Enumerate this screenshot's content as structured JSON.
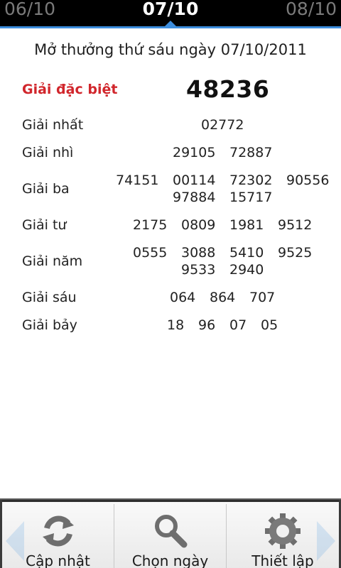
{
  "date_nav": {
    "prev": "06/10",
    "current": "07/10",
    "next": "08/10"
  },
  "heading": "Mở thưởng thứ sáu ngày 07/10/2011",
  "special": {
    "label": "Giải đặc biệt",
    "number": "48236"
  },
  "prizes": [
    {
      "label": "Giải nhất",
      "numbers": [
        "02772"
      ]
    },
    {
      "label": "Giải nhì",
      "numbers": [
        "29105",
        "72887"
      ]
    },
    {
      "label": "Giải ba",
      "numbers": [
        "74151",
        "00114",
        "72302",
        "90556",
        "97884",
        "15717"
      ]
    },
    {
      "label": "Giải tư",
      "numbers": [
        "2175",
        "0809",
        "1981",
        "9512"
      ]
    },
    {
      "label": "Giải năm",
      "numbers": [
        "0555",
        "3088",
        "5410",
        "9525",
        "9533",
        "2940"
      ]
    },
    {
      "label": "Giải sáu",
      "numbers": [
        "064",
        "864",
        "707"
      ]
    },
    {
      "label": "Giải bảy",
      "numbers": [
        "18",
        "96",
        "07",
        "05"
      ]
    }
  ],
  "toolbar": {
    "refresh_label": "Cập nhật",
    "choose_date_label": "Chọn ngày",
    "settings_label": "Thiết lập"
  },
  "colors": {
    "accent": "#3d8ede",
    "special_label": "#d1262c"
  },
  "icons": {
    "refresh": "refresh-icon",
    "search": "search-icon",
    "settings": "gear-icon"
  }
}
